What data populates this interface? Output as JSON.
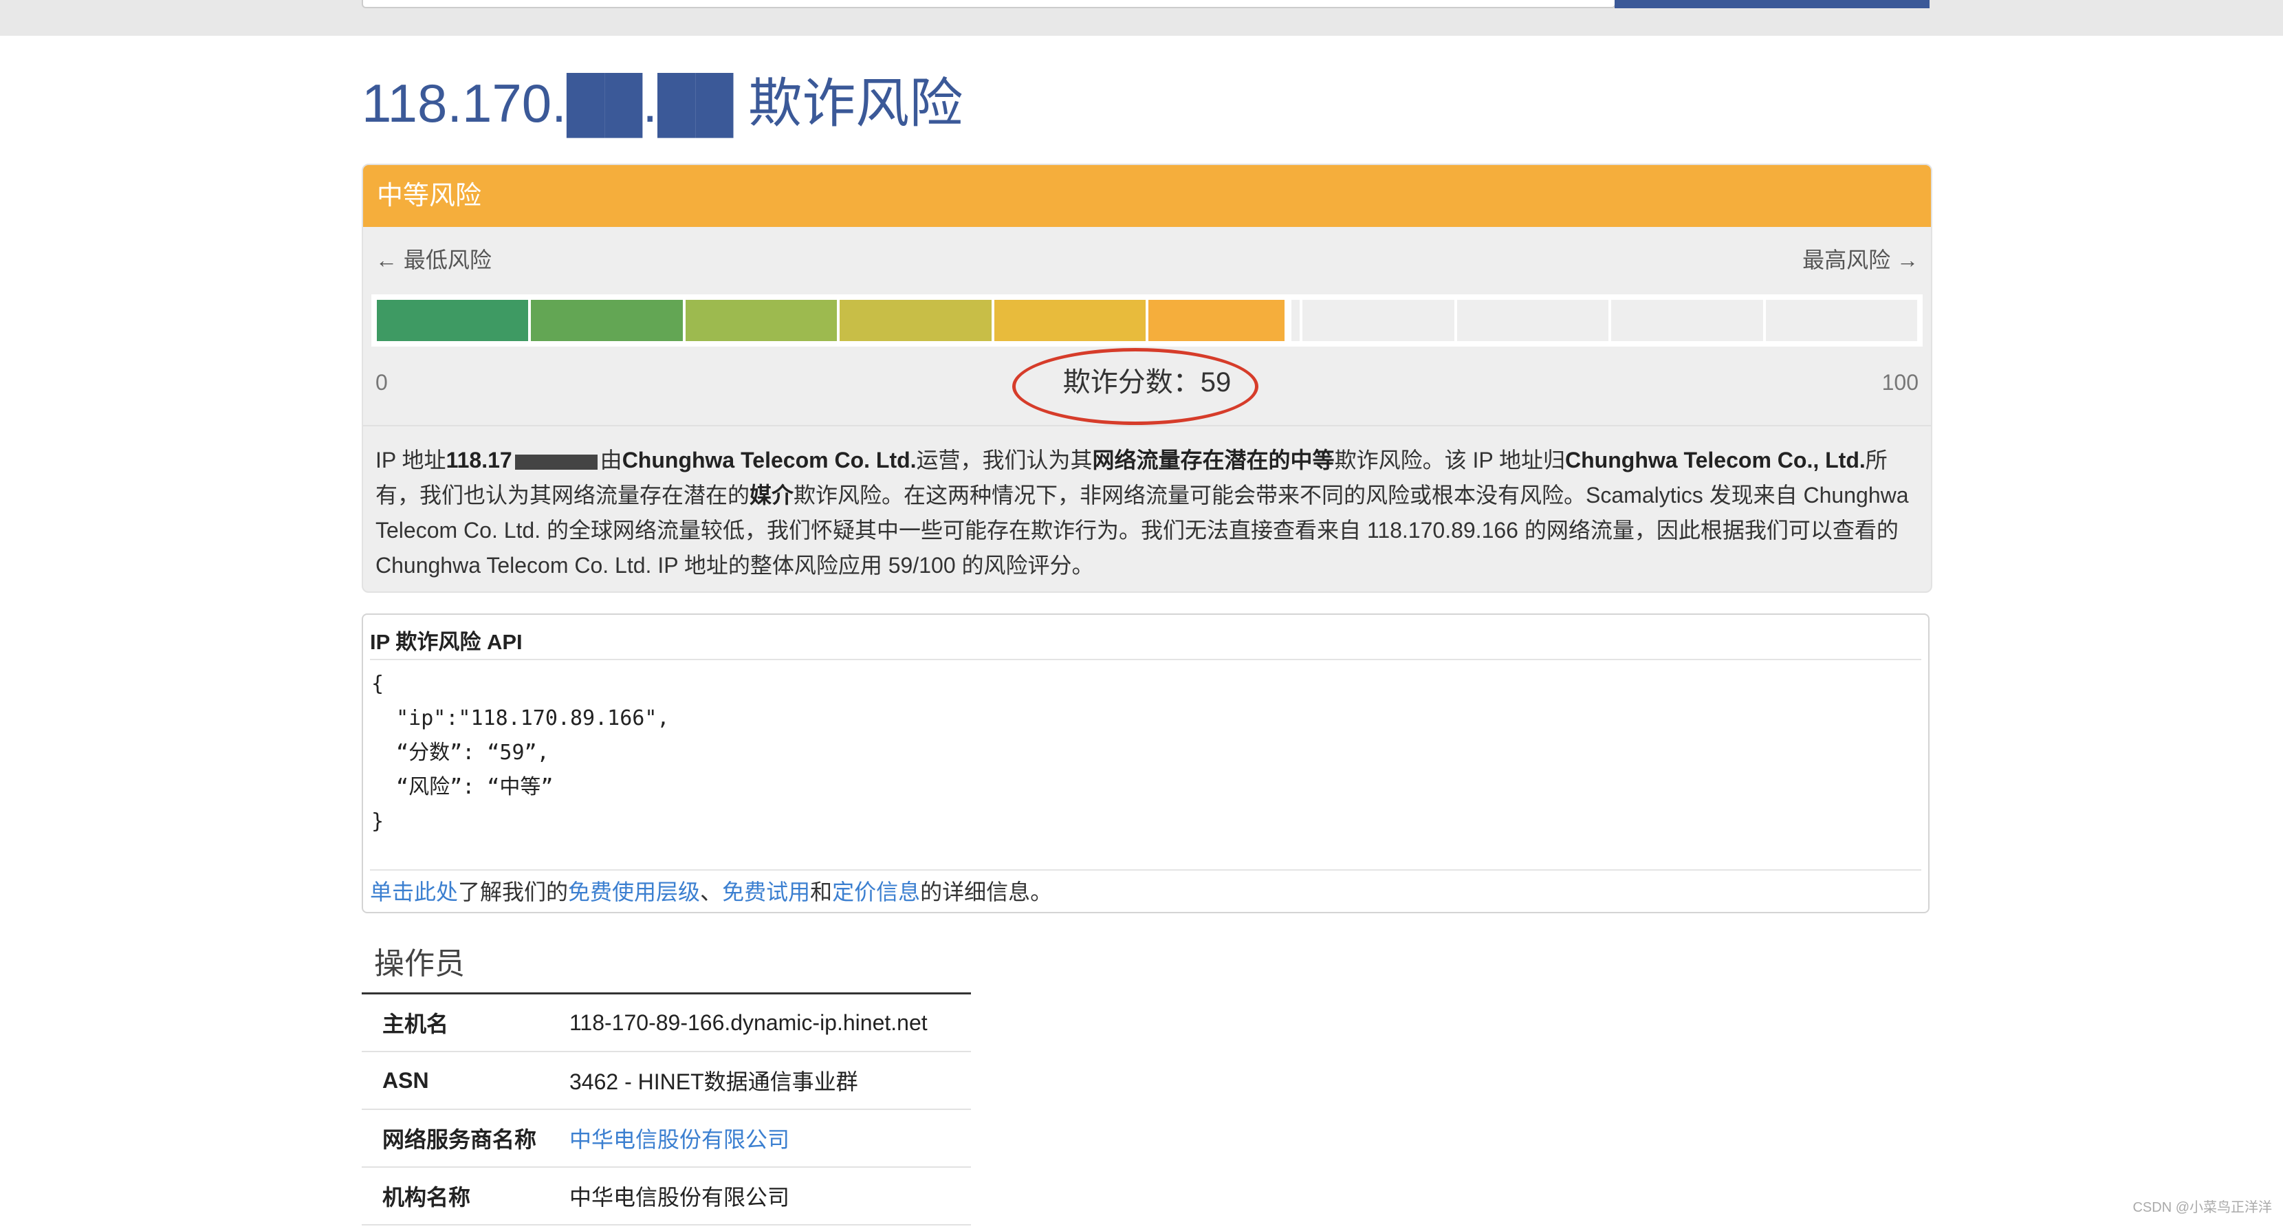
{
  "title": "118.170.██.██ 欺诈风险",
  "risk_panel": {
    "level": "中等风险",
    "low_label": "← 最低风险",
    "high_label": "最高风险 →",
    "scale_min": "0",
    "scale_max": "100",
    "score_label": "欺诈分数：59",
    "score_value": 59,
    "filled_segments": 6,
    "total_segments": 10,
    "colors": {
      "heading": "#f5ae3c",
      "seg1": "#3e9a63",
      "seg2": "#63a654",
      "seg3": "#9dba4f",
      "seg4": "#c8be47",
      "seg5": "#e8bb3c",
      "seg6": "#f5ae3c",
      "empty": "#eeeeee",
      "circle": "#d63c2a"
    }
  },
  "description": {
    "p1a": "IP 地址",
    "p1b_bold": "118.17",
    "p1c": "由",
    "p1d_bold": "Chunghwa Telecom Co. Ltd.",
    "p1e": "运营，我们认为其",
    "p1f_bold": "网络流量存在潜在的中等",
    "p1g": "欺诈风险。该 IP 地址归",
    "p1h_bold": "Chunghwa Telecom Co., Ltd.",
    "p1i": "所有，我们也认为其网络流量存在潜在的",
    "p1j_bold": "媒介",
    "p1k": "欺诈风险。在这两种情况下，非网络流量可能会带来不同的风险或根本没有风险。Scamalytics 发现来自 Chunghwa Telecom Co. Ltd. 的全球网络流量较低，我们怀疑其中一些可能存在欺诈行为。我们无法直接查看来自 118.170.89.166 的网络流量，因此根据我们可以查看的 Chunghwa Telecom Co. Ltd. IP 地址的整体风险应用 59/100 的风险评分。"
  },
  "api": {
    "title": "IP 欺诈风险 API",
    "code_lines": [
      "{",
      "  \"ip\":\"118.170.89.166\",",
      "  “分数”: “59”,",
      "  “风险”: “中等”",
      "}"
    ],
    "footer_link1": "单击此处",
    "footer_text1": "了解我们的",
    "footer_link2": "免费使用层级",
    "footer_sep": "、",
    "footer_link3": "免费试用",
    "footer_text2": "和",
    "footer_link4": "定价信息",
    "footer_text3": "的详细信息。"
  },
  "operator": {
    "title": "操作员",
    "rows": [
      {
        "key": "主机名",
        "value": "118-170-89-166.dynamic-ip.hinet.net",
        "link": false
      },
      {
        "key": "ASN",
        "value": "3462 - HINET数据通信事业群",
        "link": false
      },
      {
        "key": "网络服务商名称",
        "value": "中华电信股份有限公司",
        "link": true
      },
      {
        "key": "机构名称",
        "value": "中华电信股份有限公司",
        "link": false
      }
    ]
  },
  "watermark": "CSDN @小菜鸟正洋洋"
}
